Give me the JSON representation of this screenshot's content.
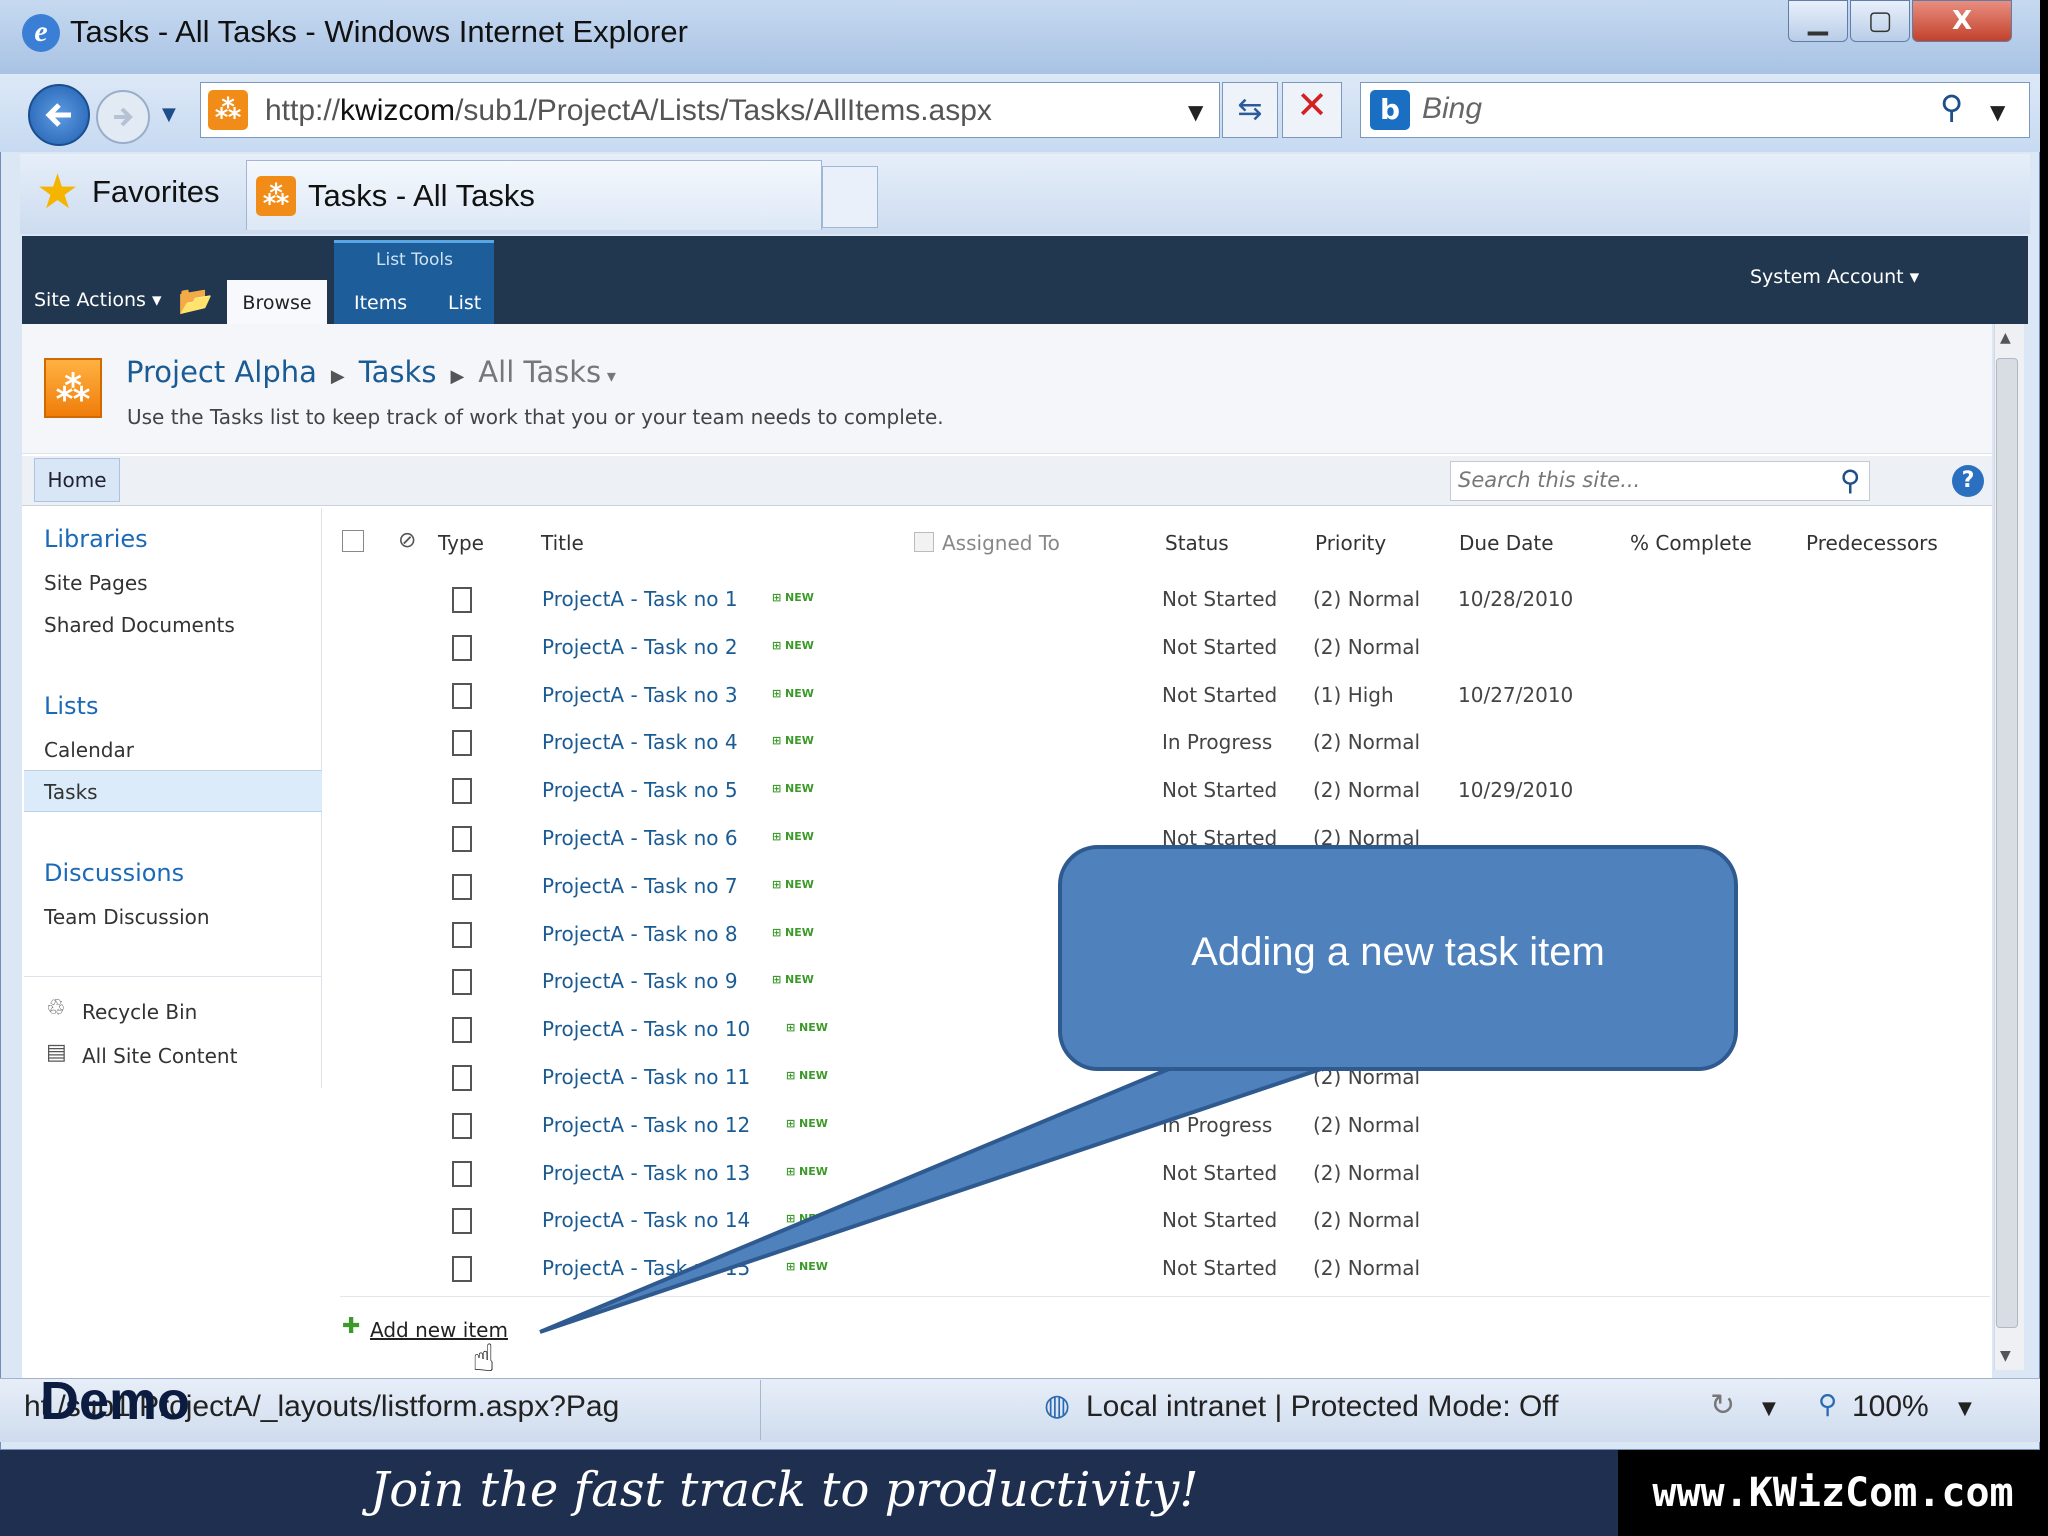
{
  "window": {
    "title": "Tasks - All Tasks - Windows Internet Explorer",
    "min": "▁",
    "max": "▢",
    "close": "X"
  },
  "nav": {
    "url_pre": "http://",
    "url_host": "kwizcom",
    "url_path": "/sub1/ProjectA/Lists/Tasks/AllItems.aspx",
    "search_placeholder": "Bing"
  },
  "favorites": {
    "label": "Favorites",
    "tab_title": "Tasks - All Tasks"
  },
  "ribbon": {
    "site_actions": "Site Actions",
    "browse": "Browse",
    "list_tools": "List Tools",
    "items": "Items",
    "list": "List",
    "account": "System Account"
  },
  "header": {
    "breadcrumb": [
      "Project Alpha",
      "Tasks",
      "All Tasks"
    ],
    "description": "Use the Tasks list to keep track of work that you or your team needs to complete."
  },
  "topnav": {
    "home": "Home",
    "search_placeholder": "Search this site..."
  },
  "quicklaunch": {
    "libraries": "Libraries",
    "site_pages": "Site Pages",
    "shared_documents": "Shared Documents",
    "lists": "Lists",
    "calendar": "Calendar",
    "tasks": "Tasks",
    "discussions": "Discussions",
    "team_discussion": "Team Discussion",
    "recycle_bin": "Recycle Bin",
    "all_site_content": "All Site Content"
  },
  "columns": {
    "type": "Type",
    "title": "Title",
    "assigned": "Assigned To",
    "status": "Status",
    "priority": "Priority",
    "due": "Due Date",
    "complete": "% Complete",
    "predecessors": "Predecessors"
  },
  "new_badge": "NEW",
  "rows": [
    {
      "title": "ProjectA - Task no 1",
      "status": "Not Started",
      "priority": "(2) Normal",
      "due": "10/28/2010"
    },
    {
      "title": "ProjectA - Task no 2",
      "status": "Not Started",
      "priority": "(2) Normal",
      "due": ""
    },
    {
      "title": "ProjectA - Task no 3",
      "status": "Not Started",
      "priority": "(1) High",
      "due": "10/27/2010"
    },
    {
      "title": "ProjectA - Task no 4",
      "status": "In Progress",
      "priority": "(2) Normal",
      "due": ""
    },
    {
      "title": "ProjectA - Task no 5",
      "status": "Not Started",
      "priority": "(2) Normal",
      "due": "10/29/2010"
    },
    {
      "title": "ProjectA - Task no 6",
      "status": "Not Started",
      "priority": "(2) Normal",
      "due": ""
    },
    {
      "title": "ProjectA - Task no 7",
      "status": "",
      "priority": "",
      "due": ""
    },
    {
      "title": "ProjectA - Task no 8",
      "status": "",
      "priority": "",
      "due": ""
    },
    {
      "title": "ProjectA - Task no 9",
      "status": "",
      "priority": "",
      "due": ""
    },
    {
      "title": "ProjectA - Task no 10",
      "status": "",
      "priority": "",
      "due": ""
    },
    {
      "title": "ProjectA - Task no 11",
      "status": "",
      "priority": "(2) Normal",
      "due": ""
    },
    {
      "title": "ProjectA - Task no 12",
      "status": "In Progress",
      "priority": "(2) Normal",
      "due": ""
    },
    {
      "title": "ProjectA - Task no 13",
      "status": "Not Started",
      "priority": "(2) Normal",
      "due": ""
    },
    {
      "title": "ProjectA - Task no 14",
      "status": "Not Started",
      "priority": "(2) Normal",
      "due": ""
    },
    {
      "title": "ProjectA - Task no 15",
      "status": "Not Started",
      "priority": "(2) Normal",
      "due": ""
    }
  ],
  "add_new": "Add new item",
  "status": {
    "url": "ht      /sub1/ProjectA/_layouts/listform.aspx?Pag",
    "zone": "Local intranet | Protected Mode: Off",
    "zoom": "100%"
  },
  "callout": "Adding a new task item",
  "demo": "Demo",
  "banner": {
    "slogan": "Join the fast track to productivity!",
    "url": "www.KWizCom.com"
  }
}
